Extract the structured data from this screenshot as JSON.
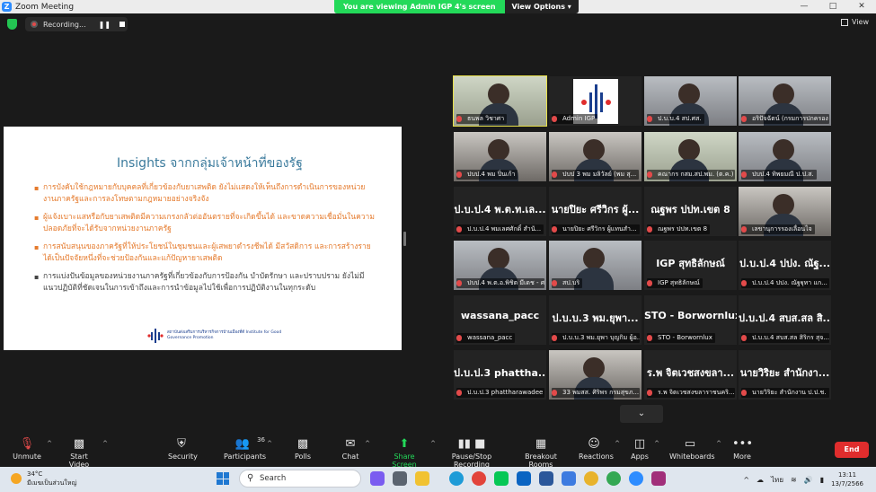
{
  "window": {
    "title": "Zoom Meeting",
    "controls": [
      "—",
      "□",
      "✕"
    ]
  },
  "banner": {
    "message": "You are viewing Admin IGP 4's screen",
    "options": "View Options"
  },
  "recording": {
    "label": "Recording...",
    "pause": "❚❚"
  },
  "view": {
    "label": "View"
  },
  "slide": {
    "title": "Insights จากกลุ่มเจ้าหน้าที่ของรัฐ",
    "bullets": [
      "การบังคับใช้กฎหมายกับบุคคลที่เกี่ยวข้องกับยาเสพติด ยังไม่แสดงให้เห็นถึงการดำเนินการของหน่วยงานภาครัฐและการลงโทษตามกฎหมายอย่างจริงจัง",
      "ผู้แจ้งเบาะแสหรือกับยาเสพติดมีความเกรงกลัวต่ออันตรายที่จะเกิดขึ้นได้ และขาดความเชื่อมั่นในความปลอดภัยที่จะได้รับจากหน่วยงานภาครัฐ",
      "การสนับสนุนของภาครัฐที่ให้ประโยชน์ในชุมชนและผู้เสพยาดำรงชีพได้ มีสวัสดิการ และการสร้างรายได้เป็นปัจจัยหนึ่งที่จะช่วยป้องกันและแก้ปัญหายาเสพติด",
      "การแบ่งปันข้อมูลของหน่วยงานภาครัฐที่เกี่ยวข้องกับการป้องกัน บำบัดรักษา และปราบปราม ยังไม่มีแนวปฏิบัติที่ชัดเจนในการเข้าถึงและการนำข้อมูลไปใช้เพื่อการปฏิบัติงานในทุกระดับ"
    ],
    "logo_text": "สถาบันส่งเสริมการบริหารกิจการบ้านเมืองที่ดี Institute for Good Governance Promotion"
  },
  "tiles": [
    {
      "name": "ธนพล วิชาศา",
      "big": "",
      "kind": "cam-man"
    },
    {
      "name": "Admin IGP",
      "big": "",
      "kind": "logo"
    },
    {
      "name": "ป.บ.บ.4 สป.ศส.",
      "big": "",
      "kind": "cam-room"
    },
    {
      "name": "อริปัจฉัตน์ (กรมการปกครอง",
      "big": "",
      "kind": "cam-room"
    },
    {
      "name": "ปบป.4 พม ปิ่นเก้า",
      "big": "",
      "kind": "cam-woman"
    },
    {
      "name": "ปบป 3 พม มลิวัลย์ (พม สุ...",
      "big": "",
      "kind": "cam-woman"
    },
    {
      "name": "คณากร กสม.สป.พม. (ต.ค.)",
      "big": "",
      "kind": "cam-man"
    },
    {
      "name": "ปบป.4 ทิพยมณี ป.ป.ส.",
      "big": "",
      "kind": "cam-room"
    },
    {
      "name": "ป.บ.ป.4 พมเลศศักดิ์ สำนั...",
      "big": "ป.บ.ป.4 พ.ต.ท.เล...",
      "kind": "name"
    },
    {
      "name": "นายปิยะ ศรีวิกร ผู้แทนสำ...",
      "big": "นายปิยะ ศรีวิกร ผู้...",
      "kind": "name"
    },
    {
      "name": "ณฐพร ปปท.เขต 8",
      "big": "ณฐพร ปปท.เขต 8",
      "kind": "name"
    },
    {
      "name": "เลขานุการรองเลื่อนไจ",
      "big": "",
      "kind": "cam-woman"
    },
    {
      "name": "ปบป.4 พ.ต.อ.พิชิต มีเดช - ศ.ป...",
      "big": "",
      "kind": "cam-room"
    },
    {
      "name": "สป.บริ",
      "big": "",
      "kind": "cam-room"
    },
    {
      "name": "IGP สุทธิลักษณ์",
      "big": "IGP สุทธิลักษณ์",
      "kind": "name"
    },
    {
      "name": "ป.บ.ป.4 ปปง. ณัฐฐุทา แก...",
      "big": "ป.บ.ป.4 ปปง. ณัฐ...",
      "kind": "name"
    },
    {
      "name": "wassana_pacc",
      "big": "wassana_pacc",
      "kind": "name"
    },
    {
      "name": "ป.บ.บ.3 พม.ยุพา บุญกิม ผู้อ...",
      "big": "ป.บ.บ.3 พม.ยุพา...",
      "kind": "name"
    },
    {
      "name": "STO - Borwornlux",
      "big": "STO - Borwornlux",
      "kind": "name"
    },
    {
      "name": "ป.บ.บ.4 สบส.สล สิริกร สุจ...",
      "big": "ป.บ.ป.4 สบส.สล สิ...",
      "kind": "name"
    },
    {
      "name": "ป.บ.ป.3 phattharawadee",
      "big": "ป.บ.ป.3 phattha...",
      "kind": "name"
    },
    {
      "name": "33 พมสส. ศิริพร กรมสุขภ...",
      "big": "",
      "kind": "cam-woman"
    },
    {
      "name": "ร.พ จิตเวชสงขลาราชนคริ...",
      "big": "ร.พ จิตเวชสงขลา...",
      "kind": "name"
    },
    {
      "name": "นายวิริยะ สำนักงาน ป.ป.ช.",
      "big": "นายวิริยะ สำนักงา...",
      "kind": "name"
    }
  ],
  "controls": {
    "unmute": "Unmute",
    "start_video": "Start Video",
    "security": "Security",
    "participants": "Participants",
    "participants_count": "36",
    "polls": "Polls",
    "chat": "Chat",
    "share": "Share Screen",
    "recording": "Pause/Stop Recording",
    "breakout": "Breakout Rooms",
    "reactions": "Reactions",
    "apps": "Apps",
    "whiteboards": "Whiteboards",
    "more": "More",
    "end": "End"
  },
  "taskbar": {
    "temperature": "34°C",
    "weather": "มีเมฆเป็นส่วนใหญ่",
    "search": "Search",
    "lang": "ไทย",
    "time": "13:11",
    "date": "13/7/2566"
  },
  "colors": {
    "accent_green": "#23d959",
    "end_red": "#e02d2d",
    "slide_orange": "#e57a2c",
    "slide_title": "#3a7a9c"
  }
}
